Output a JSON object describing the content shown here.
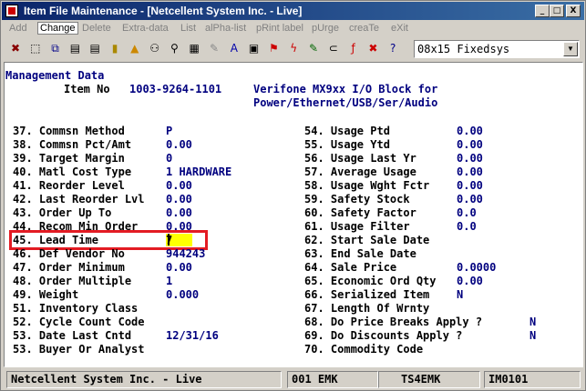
{
  "window": {
    "title": "Item File Maintenance - [Netcellent System Inc. - Live]",
    "buttons": {
      "minimize": "_",
      "maximize": "□",
      "close": "X"
    }
  },
  "menu": [
    {
      "label": "Add",
      "active": false
    },
    {
      "label": "Change",
      "active": true
    },
    {
      "label": "Delete",
      "active": false
    },
    {
      "label": "Extra-data",
      "active": false
    },
    {
      "label": "List",
      "active": false
    },
    {
      "label": "alPha-list",
      "active": false
    },
    {
      "label": "pRint label",
      "active": false
    },
    {
      "label": "pUrge",
      "active": false
    },
    {
      "label": "creaTe",
      "active": false
    },
    {
      "label": "eXit",
      "active": false
    }
  ],
  "toolbar": {
    "icons": [
      "close-x-icon",
      "new-window-icon",
      "copy-icon",
      "print-icon",
      "notes-icon",
      "lock-icon",
      "alert-icon",
      "binoculars-icon",
      "magnify-icon",
      "calculator-icon",
      "paint-icon",
      "font-icon",
      "image-icon",
      "flag-icon",
      "lightning-icon",
      "edit-page-icon",
      "link-icon",
      "function-icon",
      "cancel-page-icon",
      "help-arrow-icon"
    ],
    "glyphs": [
      "✖",
      "⬚",
      "⧉",
      "▤",
      "▤",
      "▮",
      "▲",
      "⚇",
      "⚲",
      "▦",
      "✎",
      "A",
      "▣",
      "⚑",
      "ϟ",
      "✎",
      "⊂",
      "ƒ",
      "✖",
      "?"
    ],
    "font_select": "08x15 Fixedsys"
  },
  "screen": {
    "section_title": "Management Data",
    "item_no_label": "Item No",
    "item_no": "1003-9264-1101",
    "description_1": "Verifone MX9xx I/O Block for",
    "description_2": "Power/Ethernet/USB/Ser/Audio",
    "left_fields": [
      {
        "label": "37. Commsn Method",
        "value": "P"
      },
      {
        "label": "38. Commsn Pct/Amt",
        "value": "0.00"
      },
      {
        "label": "39. Target Margin",
        "value": "0"
      },
      {
        "label": "40. Matl Cost Type",
        "value": "1 HARDWARE"
      },
      {
        "label": "41. Reorder Level",
        "value": "0.00"
      },
      {
        "label": "42. Last Reorder Lvl",
        "value": "0.00"
      },
      {
        "label": "43. Order Up To",
        "value": "0.00"
      },
      {
        "label": "44. Recom Min Order",
        "value": "0.00"
      },
      {
        "label": "45. Lead Time",
        "value": "7"
      },
      {
        "label": "46. Def Vendor No",
        "value": "944243"
      },
      {
        "label": "47. Order Minimum",
        "value": "0.00"
      },
      {
        "label": "48. Order Multiple",
        "value": "1"
      },
      {
        "label": "49. Weight",
        "value": "0.000"
      },
      {
        "label": "51. Inventory Class",
        "value": ""
      },
      {
        "label": "52. Cycle Count Code",
        "value": ""
      },
      {
        "label": "53. Date Last Cntd",
        "value": "12/31/16"
      },
      {
        "label": "53. Buyer Or Analyst",
        "value": ""
      }
    ],
    "right_fields": [
      {
        "label": "54. Usage Ptd",
        "value": "0.00"
      },
      {
        "label": "55. Usage Ytd",
        "value": "0.00"
      },
      {
        "label": "56. Usage Last Yr",
        "value": "0.00"
      },
      {
        "label": "57. Average Usage",
        "value": "0.00"
      },
      {
        "label": "58. Usage Wght Fctr",
        "value": "0.00"
      },
      {
        "label": "59. Safety Stock",
        "value": "0.00"
      },
      {
        "label": "60. Safety Factor",
        "value": "0.0"
      },
      {
        "label": "61. Usage Filter",
        "value": "0.0"
      },
      {
        "label": "62. Start Sale Date",
        "value": ""
      },
      {
        "label": "63. End Sale Date",
        "value": ""
      },
      {
        "label": "64. Sale Price",
        "value": "0.0000"
      },
      {
        "label": "65. Economic Ord Qty",
        "value": "0.00"
      },
      {
        "label": "66. Serialized Item",
        "value": "N"
      },
      {
        "label": "67. Length Of Wrnty",
        "value": ""
      },
      {
        "label": "68. Do Price Breaks Apply ?",
        "value": "N"
      },
      {
        "label": "69. Do Discounts Apply ?",
        "value": "N"
      },
      {
        "label": "70. Commodity Code",
        "value": ""
      }
    ]
  },
  "status": {
    "company": "Netcellent System Inc. - Live",
    "session": "001 EMK",
    "terminal": "TS4EMK",
    "program": "IM0101"
  }
}
